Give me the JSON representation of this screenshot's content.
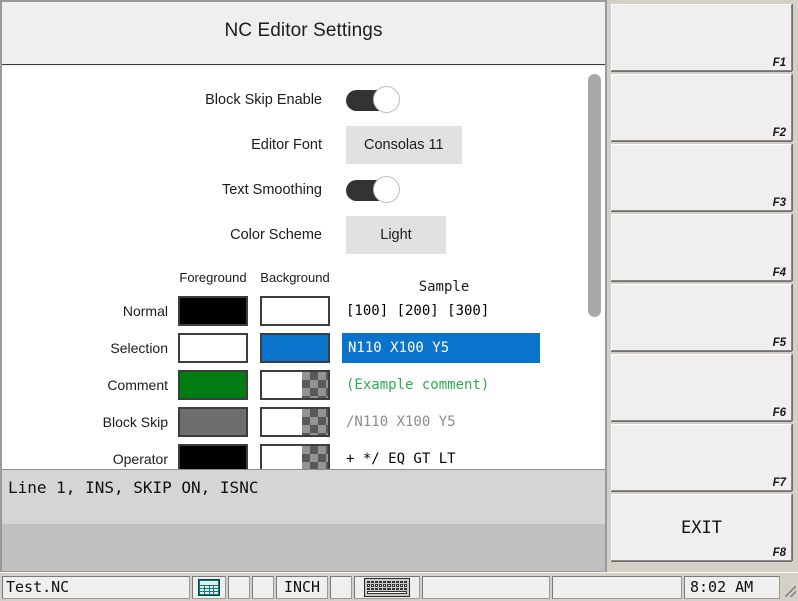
{
  "window": {
    "title": "NC Editor Settings"
  },
  "settings": [
    {
      "label": "Block Skip Enable",
      "control": "toggle",
      "value": "off",
      "name": "block-skip-enable"
    },
    {
      "label": "Editor Font",
      "control": "combo",
      "value": "Consolas 11",
      "name": "editor-font"
    },
    {
      "label": "Text Smoothing",
      "control": "toggle",
      "value": "off",
      "name": "text-smoothing"
    },
    {
      "label": "Color Scheme",
      "control": "combo",
      "value": "Light",
      "name": "color-scheme"
    }
  ],
  "color_table": {
    "headers": {
      "foreground": "Foreground",
      "background": "Background",
      "sample": "Sample"
    },
    "rows": [
      {
        "label": "Normal",
        "fg": "#000000",
        "bg": "#ffffff",
        "bg_transparent": false,
        "sample_text": "[100] [200] [300]",
        "sample_fg": "#000000",
        "sample_bg": "transparent"
      },
      {
        "label": "Selection",
        "fg": "#ffffff",
        "bg": "#0a74cc",
        "bg_transparent": false,
        "sample_text": "N110 X100 Y5",
        "sample_fg": "#ffffff",
        "sample_bg": "#0a74cc"
      },
      {
        "label": "Comment",
        "fg": "#007d12",
        "bg": "#ffffff",
        "bg_transparent": true,
        "sample_text": "(Example comment)",
        "sample_fg": "#2dab52",
        "sample_bg": "transparent"
      },
      {
        "label": "Block Skip",
        "fg": "#6e6e6e",
        "bg": "#ffffff",
        "bg_transparent": true,
        "sample_text": "/N110 X100 Y5",
        "sample_fg": "#8c8c8c",
        "sample_bg": "transparent"
      },
      {
        "label": "Operator",
        "fg": "#000000",
        "bg": "#ffffff",
        "bg_transparent": true,
        "sample_text": "+ */ EQ GT LT",
        "sample_fg": "#000000",
        "sample_bg": "transparent"
      }
    ]
  },
  "status": {
    "line": "Line 1, INS, SKIP ON, ISNC"
  },
  "fkeys": [
    {
      "id": "F1",
      "caption": ""
    },
    {
      "id": "F2",
      "caption": ""
    },
    {
      "id": "F3",
      "caption": ""
    },
    {
      "id": "F4",
      "caption": ""
    },
    {
      "id": "F5",
      "caption": ""
    },
    {
      "id": "F6",
      "caption": ""
    },
    {
      "id": "F7",
      "caption": ""
    },
    {
      "id": "F8",
      "caption": "EXIT"
    }
  ],
  "taskbar": {
    "filename": "Test.NC",
    "calc_icon": "calculator-icon",
    "units": "INCH",
    "keyboard_icon": "keyboard-icon",
    "time": "8:02 AM"
  },
  "colors": {
    "accent_blue": "#0a74cc",
    "comment_green": "#007d12",
    "block_skip_gray": "#6e6e6e",
    "window_chrome": "#d4d0c8",
    "panel_bg": "#efefef"
  }
}
